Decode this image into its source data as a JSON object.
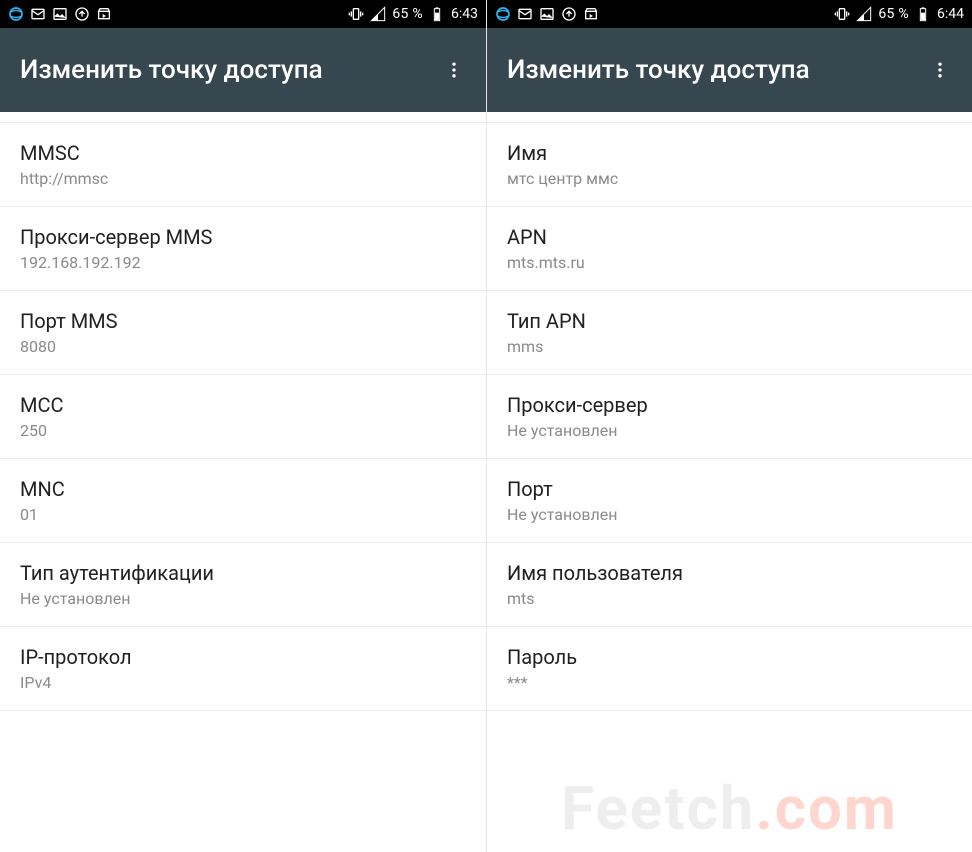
{
  "left": {
    "status": {
      "battery": "65 %",
      "clock": "6:43"
    },
    "appbar": {
      "title": "Изменить точку доступа"
    },
    "rows": [
      {
        "label": "MMSC",
        "value": "http://mmsc"
      },
      {
        "label": "Прокси-сервер MMS",
        "value": "192.168.192.192"
      },
      {
        "label": "Порт MMS",
        "value": "8080"
      },
      {
        "label": "MCC",
        "value": "250"
      },
      {
        "label": "MNC",
        "value": "01"
      },
      {
        "label": "Тип аутентификации",
        "value": "Не установлен"
      },
      {
        "label": "IP-протокол",
        "value": "IPv4"
      }
    ]
  },
  "right": {
    "status": {
      "battery": "65 %",
      "clock": "6:44"
    },
    "appbar": {
      "title": "Изменить точку доступа"
    },
    "rows": [
      {
        "label": "Имя",
        "value": "мтс центр ммс"
      },
      {
        "label": "APN",
        "value": "mts.mts.ru"
      },
      {
        "label": "Тип APN",
        "value": "mms"
      },
      {
        "label": "Прокси-сервер",
        "value": "Не установлен"
      },
      {
        "label": "Порт",
        "value": "Не установлен"
      },
      {
        "label": "Имя пользователя",
        "value": "mts"
      },
      {
        "label": "Пароль",
        "value": "***"
      }
    ]
  },
  "watermark": {
    "part1": "Feetch",
    "part2": ".com"
  }
}
